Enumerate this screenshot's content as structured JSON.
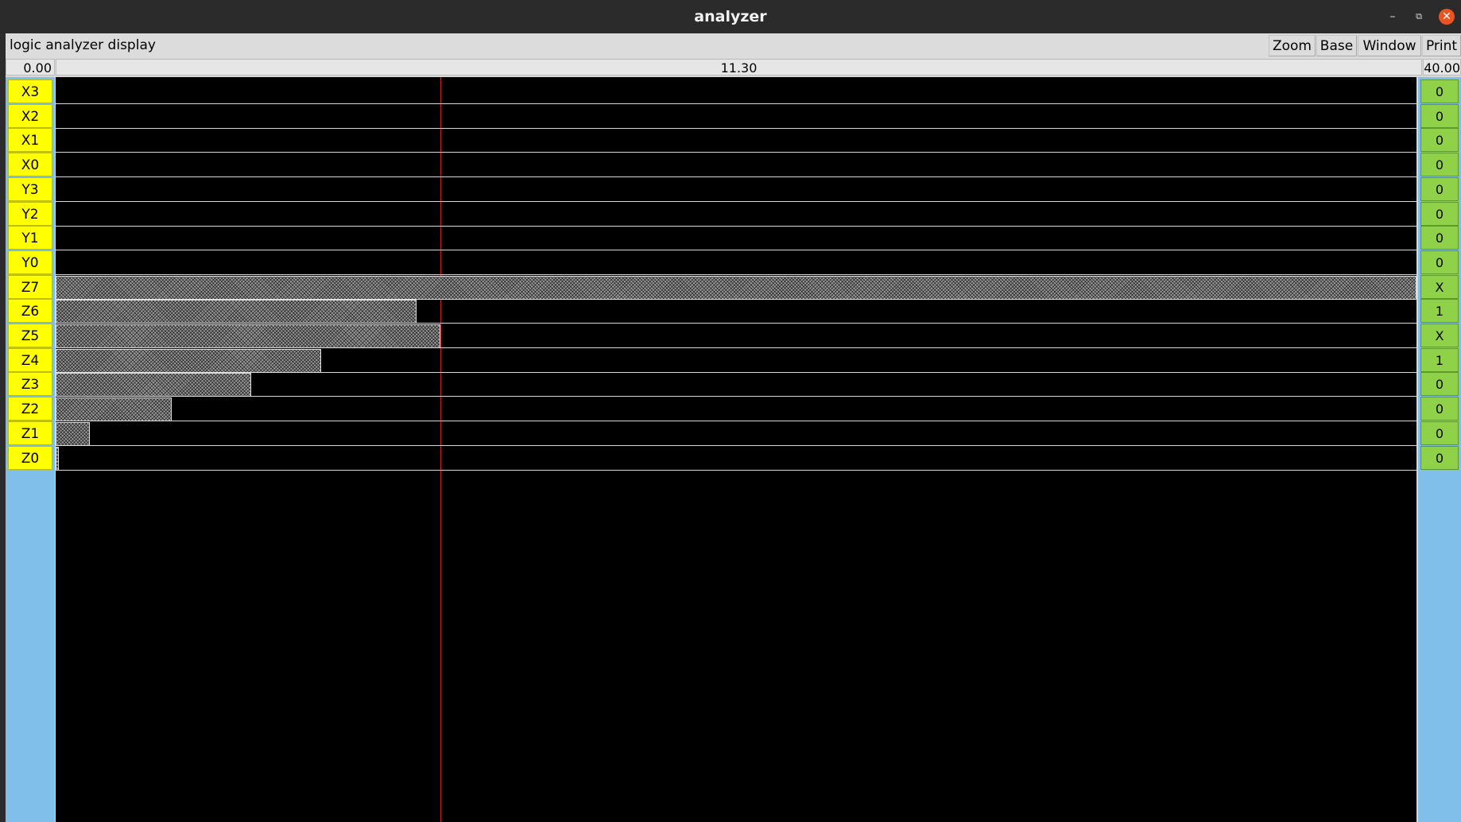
{
  "window": {
    "title": "analyzer",
    "minimize_glyph": "–",
    "restore_glyph": "⧉",
    "close_glyph": "✕"
  },
  "menubar": {
    "app_label": "logic analyzer display",
    "buttons": [
      "Zoom",
      "Base",
      "Window",
      "Print"
    ]
  },
  "timebar": {
    "start": "0.00",
    "cursor": "11.30",
    "end": "40.00"
  },
  "time_range": [
    0,
    40
  ],
  "cursor_time": 11.3,
  "signals": [
    {
      "name": "X3",
      "value": "0",
      "fill_end": null
    },
    {
      "name": "X2",
      "value": "0",
      "fill_end": null
    },
    {
      "name": "X1",
      "value": "0",
      "fill_end": null
    },
    {
      "name": "X0",
      "value": "0",
      "fill_end": null
    },
    {
      "name": "Y3",
      "value": "0",
      "fill_end": null
    },
    {
      "name": "Y2",
      "value": "0",
      "fill_end": null
    },
    {
      "name": "Y1",
      "value": "0",
      "fill_end": null
    },
    {
      "name": "Y0",
      "value": "0",
      "fill_end": null
    },
    {
      "name": "Z7",
      "value": "X",
      "fill_end": 40.0
    },
    {
      "name": "Z6",
      "value": "1",
      "fill_end": 10.6
    },
    {
      "name": "Z5",
      "value": "X",
      "fill_end": 11.3
    },
    {
      "name": "Z4",
      "value": "1",
      "fill_end": 7.8
    },
    {
      "name": "Z3",
      "value": "0",
      "fill_end": 5.75
    },
    {
      "name": "Z2",
      "value": "0",
      "fill_end": 3.4
    },
    {
      "name": "Z1",
      "value": "0",
      "fill_end": 1.0
    },
    {
      "name": "Z0",
      "value": "0",
      "fill_end": 0.1
    }
  ],
  "colors": {
    "label_bg": "#ffff00",
    "value_bg": "#8fd24a",
    "panel_bg": "#7fbfea",
    "wave_bg": "#000000",
    "cursor": "#c11b1b",
    "close_button": "#e95420"
  }
}
